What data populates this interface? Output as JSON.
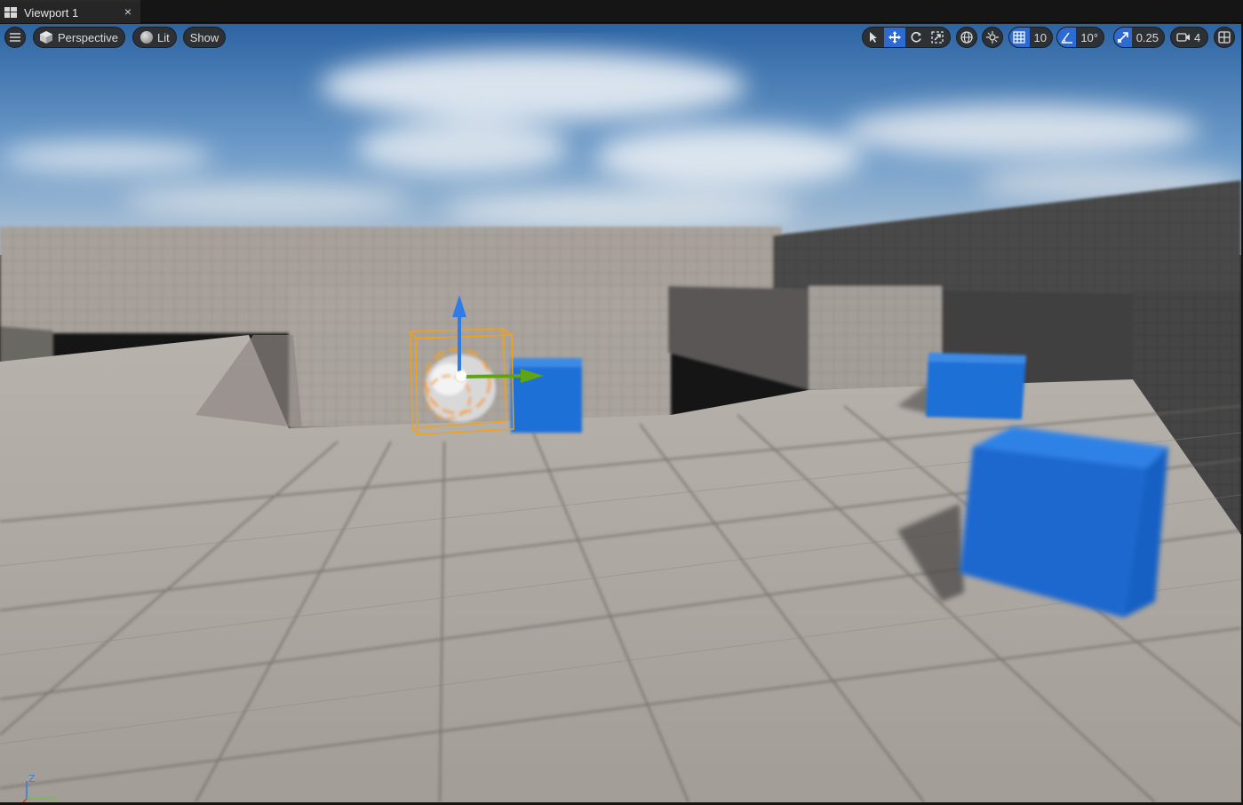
{
  "tab": {
    "title": "Viewport 1",
    "close": "×"
  },
  "toolbar": {
    "view_mode": "Perspective",
    "lighting": "Lit",
    "show": "Show",
    "grid_snap": "10",
    "rotation_snap": "10°",
    "scale_snap": "0.25",
    "camera_speed": "4"
  },
  "axis_gizmo": {
    "z": "Z",
    "y": "Y"
  },
  "colors": {
    "accent": "#2d6bd3",
    "selection": "#f0a21a",
    "cube": "#1a6fd6"
  }
}
